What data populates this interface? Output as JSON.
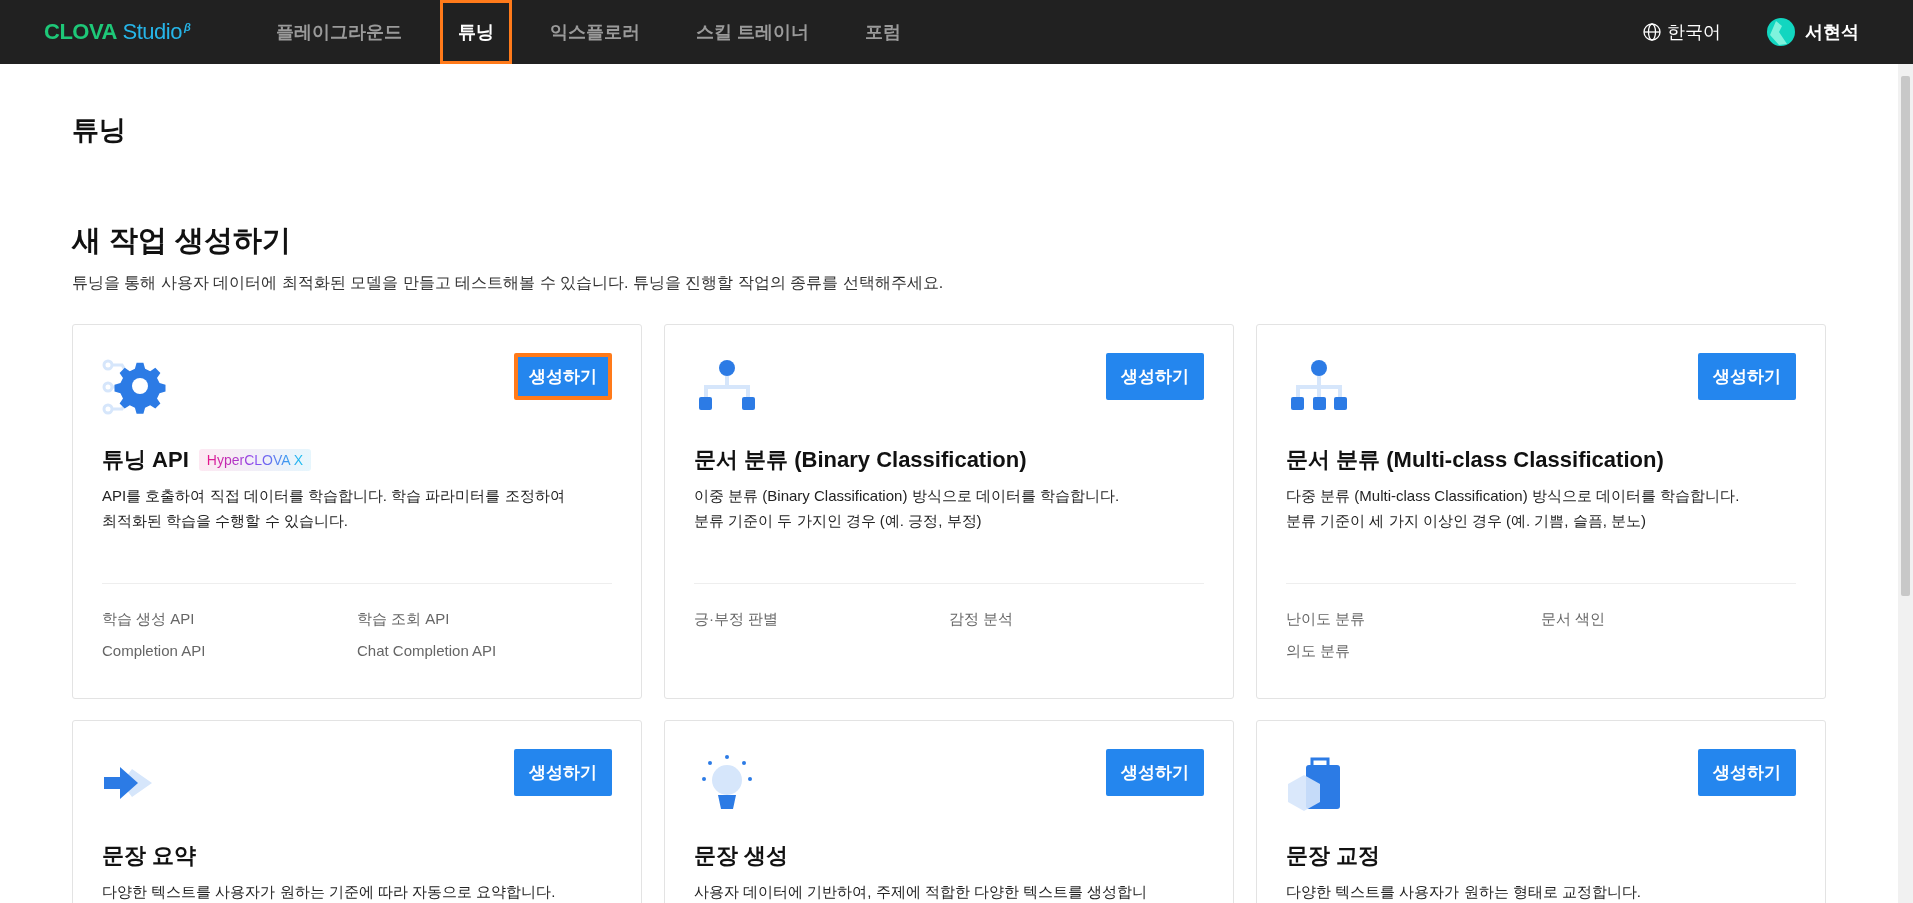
{
  "header": {
    "logo": "CLOVA Studio",
    "logo_mark": "β",
    "nav": [
      {
        "label": "플레이그라운드",
        "selected": false,
        "highlighted": false
      },
      {
        "label": "튜닝",
        "selected": true,
        "highlighted": true
      },
      {
        "label": "익스플로러",
        "selected": false,
        "highlighted": false
      },
      {
        "label": "스킬 트레이너",
        "selected": false,
        "highlighted": false
      },
      {
        "label": "포럼",
        "selected": false,
        "highlighted": false
      }
    ],
    "language": "한국어",
    "user": "서현석"
  },
  "page_title": "튜닝",
  "section": {
    "title": "새 작업 생성하기",
    "description": "튜닝을 통해 사용자 데이터에 최적화된 모델을 만들고 테스트해볼 수 있습니다. 튜닝을 진행할 작업의 종류를 선택해주세요."
  },
  "cards": [
    {
      "kind": "gear",
      "title": "튜닝 API",
      "badge": "HyperCLOVA X",
      "button": "생성하기",
      "button_highlighted": true,
      "description": [
        "API를 호출하여 직접 데이터를 학습합니다. 학습 파라미터를 조정하여",
        "최적화된 학습을 수행할 수 있습니다."
      ],
      "links": [
        "학습 생성 API",
        "학습 조회 API",
        "Completion API",
        "Chat Completion API"
      ]
    },
    {
      "kind": "tree2",
      "title": "문서 분류 (Binary Classification)",
      "button": "생성하기",
      "button_highlighted": false,
      "description": [
        "이중 분류 (Binary Classification) 방식으로 데이터를 학습합니다.",
        "분류 기준이 두 가지인 경우 (예. 긍정, 부정)"
      ],
      "links": [
        "긍·부정 판별",
        "감정 분석"
      ]
    },
    {
      "kind": "tree3",
      "title": "문서 분류 (Multi-class Classification)",
      "button": "생성하기",
      "button_highlighted": false,
      "description": [
        "다중 분류 (Multi-class Classification) 방식으로 데이터를 학습합니다.",
        "분류 기준이 세 가지 이상인 경우 (예. 기쁨, 슬픔, 분노)"
      ],
      "links": [
        "난이도 분류",
        "문서 색인",
        "의도 분류"
      ]
    },
    {
      "kind": "arrow",
      "title": "문장 요약",
      "button": "생성하기",
      "button_highlighted": false,
      "description": [
        "다양한 텍스트를 사용자가 원하는 기준에 따라 자동으로 요약합니다."
      ]
    },
    {
      "kind": "bulb",
      "title": "문장 생성",
      "button": "생성하기",
      "button_highlighted": false,
      "description": [
        "사용자 데이터에 기반하여, 주제에 적합한 다양한 텍스트를 생성합니"
      ]
    },
    {
      "kind": "case",
      "title": "문장 교정",
      "button": "생성하기",
      "button_highlighted": false,
      "description": [
        "다양한 텍스트를 사용자가 원하는 형태로 교정합니다."
      ]
    }
  ]
}
